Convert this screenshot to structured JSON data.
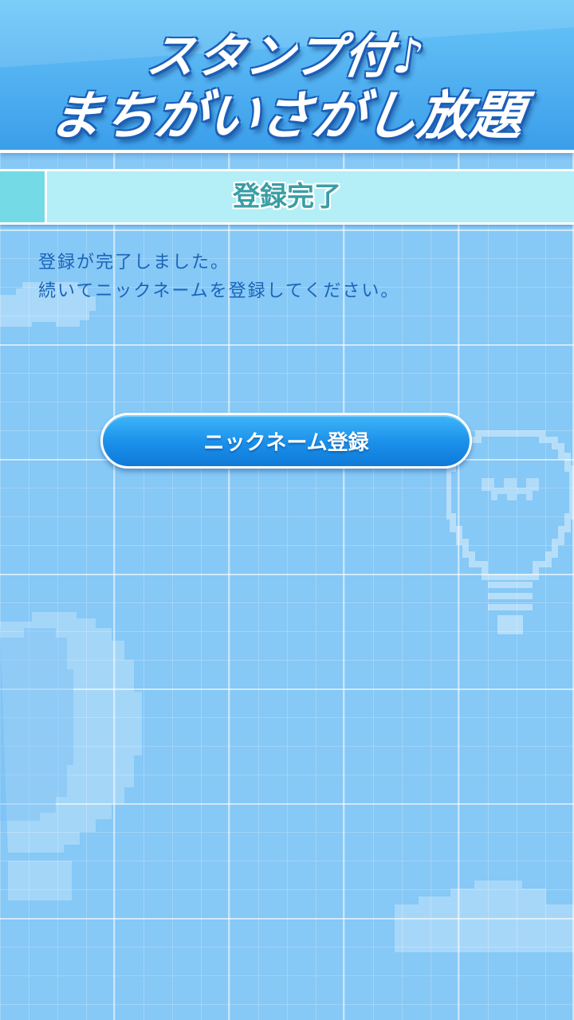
{
  "header": {
    "logo_line_1": "スタンプ付♪",
    "logo_line_2": "まちがいさがし放題"
  },
  "section": {
    "title": "登録完了"
  },
  "message": {
    "line_1": "登録が完了しました。",
    "line_2": "続いてニックネームを登録してください。"
  },
  "actions": {
    "nickname_button_label": "ニックネーム登録"
  },
  "colors": {
    "background": "#86c8f6",
    "header": "#3b9eea",
    "banner": "#b4eef6",
    "banner_text": "#3a9ea4",
    "message_text": "#1a64b8",
    "button": "#1a8fea"
  },
  "decorations": [
    "cloud-icon",
    "lightbulb-icon",
    "hot-air-balloon-icon",
    "cloud-icon"
  ]
}
